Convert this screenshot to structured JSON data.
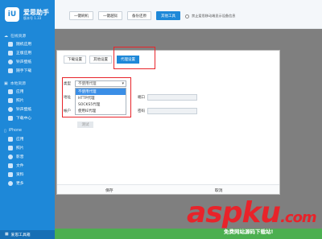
{
  "brand": {
    "logo_letters": "iU",
    "title": "爱思助手",
    "version": "版本号 1.33"
  },
  "sidebar": {
    "sections": [
      {
        "title": "在线资源",
        "items": [
          "随机应用",
          "正版应用",
          "铃声壁纸",
          "随手下载"
        ]
      },
      {
        "title": "本地资源",
        "items": [
          "应用",
          "照片",
          "铃声壁纸",
          "下载中心"
        ]
      },
      {
        "title": "iPhone",
        "items": [
          "应用",
          "照片",
          "影音",
          "文件",
          "资料",
          "更多"
        ]
      }
    ],
    "footer": "爱思工具箱"
  },
  "topbar": {
    "buttons": [
      "一键刷机",
      "一键越狱",
      "备份还原",
      "其他工具"
    ],
    "checkbox_label": "禁止爱思移动端显示设备信息"
  },
  "dialog": {
    "tabs": [
      "下载设置",
      "其他设置",
      "代理设置"
    ],
    "type_label": "类型",
    "selected": "不使用代理",
    "options": [
      "不使用代理",
      "HTTP代理",
      "SOCKS5代理",
      "使用IE代理"
    ],
    "address_label": "地址",
    "port_label": "端口",
    "account_label": "帐户",
    "password_label": "密码",
    "test_label": "测试",
    "save_label": "保存",
    "cancel_label": "取消"
  },
  "watermark": {
    "main": "aspku",
    "tld": ".com",
    "sub": "免费网站源码下载站!"
  }
}
